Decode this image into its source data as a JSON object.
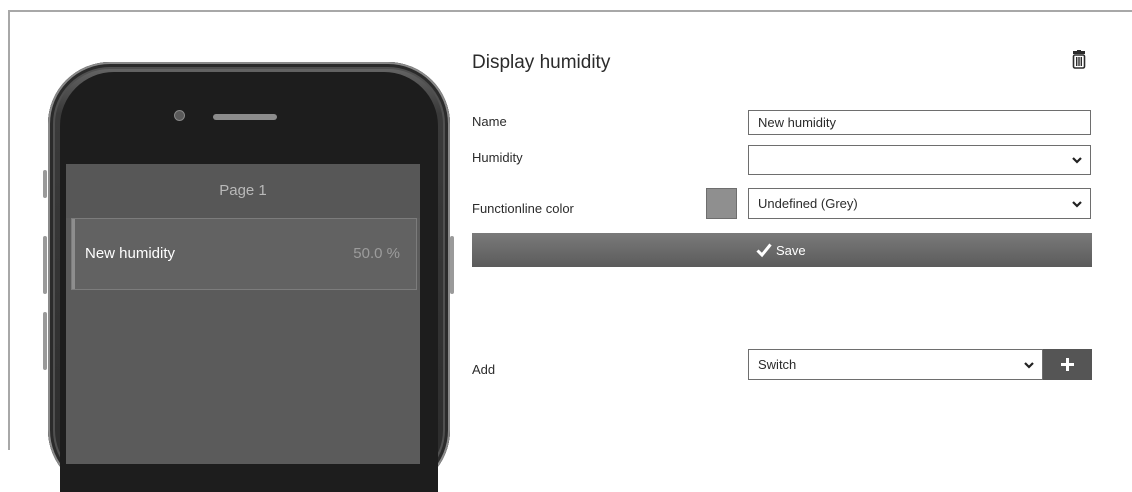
{
  "phone": {
    "page_title": "Page 1",
    "item": {
      "label": "New humidity",
      "value": "50.0 %"
    }
  },
  "editor": {
    "title": "Display humidity",
    "delete_icon": "trash-icon",
    "fields": {
      "name": {
        "label": "Name",
        "value": "New humidity"
      },
      "humidity": {
        "label": "Humidity",
        "value": ""
      },
      "functionline_color": {
        "label": "Functionline color",
        "value": "Undefined (Grey)",
        "swatch_color": "#8f8f8f"
      }
    },
    "save": {
      "label": "Save",
      "icon": "checkmark-icon"
    },
    "add": {
      "label": "Add",
      "value": "Switch",
      "button_icon": "plus-icon"
    }
  },
  "colors": {
    "phone_screen": "#5b5b5b",
    "save_button": "#666666",
    "add_button": "#555555"
  }
}
